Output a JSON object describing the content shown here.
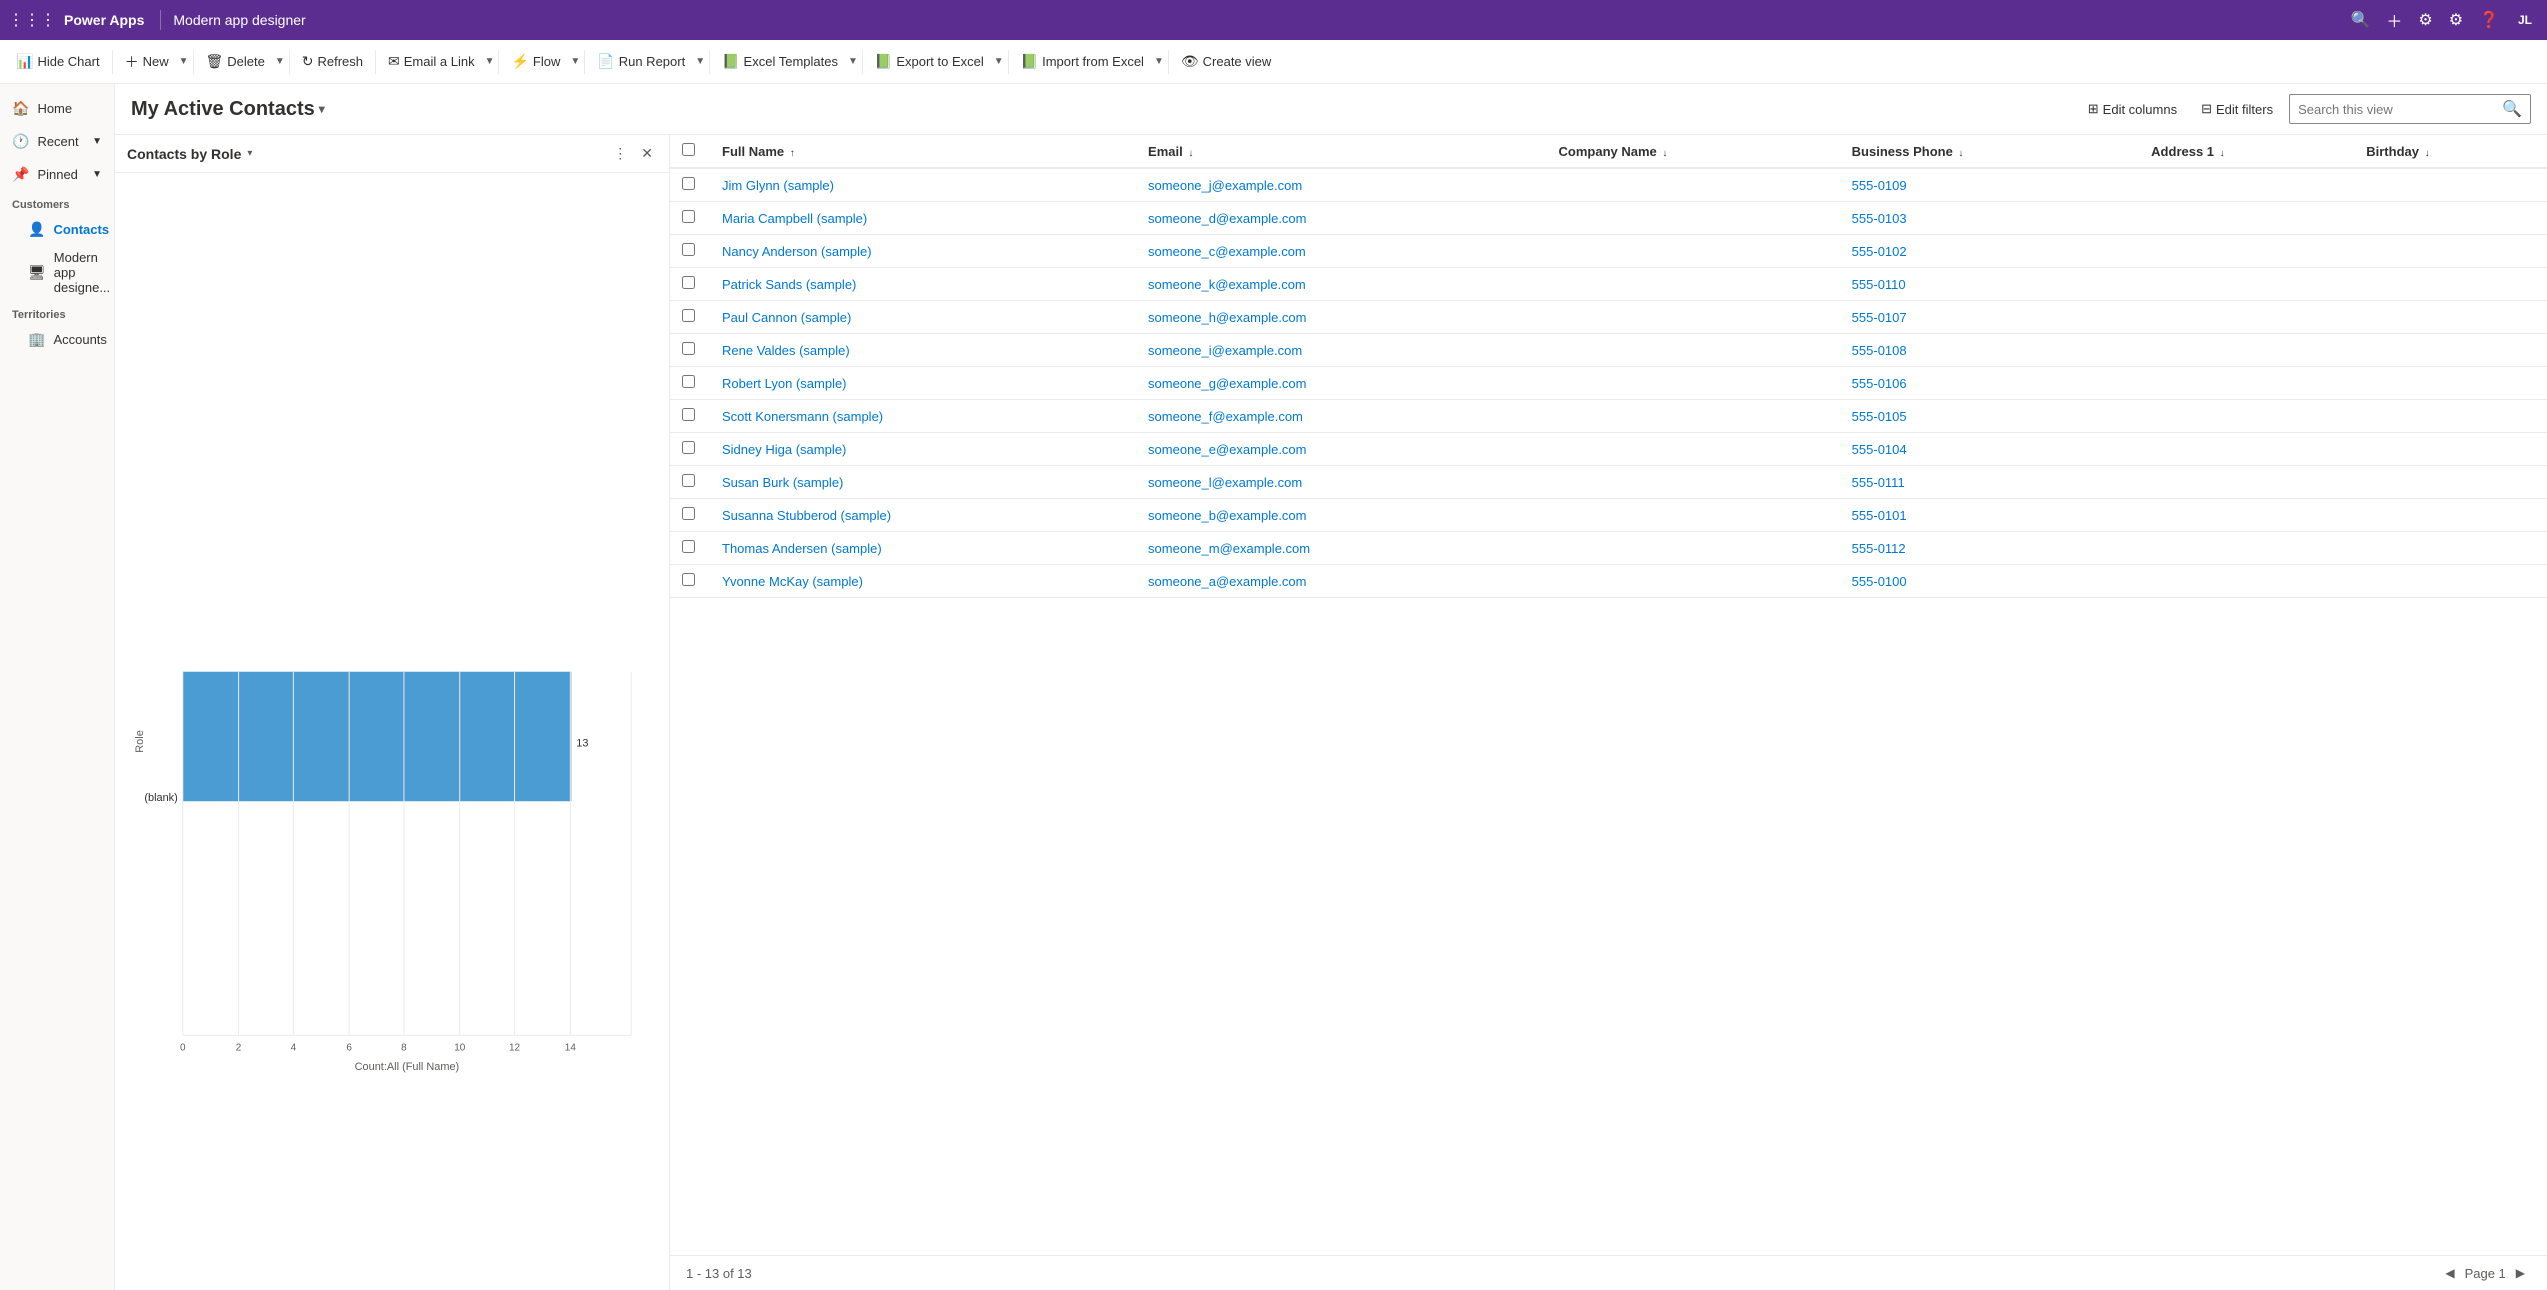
{
  "app": {
    "name": "Power Apps",
    "page_name": "Modern app designer",
    "user_initials": "JL"
  },
  "toolbar": {
    "buttons": [
      {
        "id": "hide-chart",
        "label": "Hide Chart",
        "icon": "📊"
      },
      {
        "id": "new",
        "label": "New",
        "icon": "＋"
      },
      {
        "id": "delete",
        "label": "Delete",
        "icon": "🗑"
      },
      {
        "id": "refresh",
        "label": "Refresh",
        "icon": "↻"
      },
      {
        "id": "email-link",
        "label": "Email a Link",
        "icon": "✉"
      },
      {
        "id": "flow",
        "label": "Flow",
        "icon": "⚡"
      },
      {
        "id": "run-report",
        "label": "Run Report",
        "icon": "📄"
      },
      {
        "id": "excel-templates",
        "label": "Excel Templates",
        "icon": "📗"
      },
      {
        "id": "export-to-excel",
        "label": "Export to Excel",
        "icon": "📗"
      },
      {
        "id": "import-from-excel",
        "label": "Import from Excel",
        "icon": "📗"
      },
      {
        "id": "create-view",
        "label": "Create view",
        "icon": "👁"
      }
    ]
  },
  "sidebar": {
    "nav_items": [
      {
        "id": "home",
        "label": "Home",
        "icon": "🏠",
        "has_expand": false
      },
      {
        "id": "recent",
        "label": "Recent",
        "icon": "🕐",
        "has_expand": true
      },
      {
        "id": "pinned",
        "label": "Pinned",
        "icon": "📌",
        "has_expand": true
      }
    ],
    "sections": [
      {
        "header": "Customers",
        "items": [
          {
            "id": "contacts",
            "label": "Contacts",
            "icon": "👤",
            "active": true
          },
          {
            "id": "modern-app-designer",
            "label": "Modern app designe...",
            "icon": "🖥",
            "active": false
          }
        ]
      },
      {
        "header": "Territories",
        "items": [
          {
            "id": "accounts",
            "label": "Accounts",
            "icon": "🏢",
            "active": false
          }
        ]
      }
    ]
  },
  "view": {
    "title": "My Active Contacts",
    "actions": [
      {
        "id": "edit-columns",
        "label": "Edit columns",
        "icon": "⊞"
      },
      {
        "id": "edit-filters",
        "label": "Edit filters",
        "icon": "⊟"
      },
      {
        "id": "search-view",
        "placeholder": "Search this view"
      }
    ]
  },
  "chart": {
    "title": "Contacts by Role",
    "bar_label": "(blank)",
    "bar_value": 13,
    "axis_label": "Count:All (Full Name)",
    "y_axis_label": "Role",
    "x_ticks": [
      0,
      2,
      4,
      6,
      8,
      10,
      12,
      14
    ],
    "bar_color": "#4c9cd4"
  },
  "grid": {
    "columns": [
      {
        "id": "full-name",
        "label": "Full Name",
        "sortable": true,
        "sort": "asc"
      },
      {
        "id": "email",
        "label": "Email",
        "sortable": true
      },
      {
        "id": "company-name",
        "label": "Company Name",
        "sortable": true
      },
      {
        "id": "business-phone",
        "label": "Business Phone",
        "sortable": true
      },
      {
        "id": "address1",
        "label": "Address 1",
        "sortable": true
      },
      {
        "id": "birthday",
        "label": "Birthday",
        "sortable": true
      }
    ],
    "rows": [
      {
        "name": "Jim Glynn (sample)",
        "email": "someone_j@example.com",
        "company": "",
        "phone": "555-0109",
        "address": "",
        "birthday": ""
      },
      {
        "name": "Maria Campbell (sample)",
        "email": "someone_d@example.com",
        "company": "",
        "phone": "555-0103",
        "address": "",
        "birthday": ""
      },
      {
        "name": "Nancy Anderson (sample)",
        "email": "someone_c@example.com",
        "company": "",
        "phone": "555-0102",
        "address": "",
        "birthday": ""
      },
      {
        "name": "Patrick Sands (sample)",
        "email": "someone_k@example.com",
        "company": "",
        "phone": "555-0110",
        "address": "",
        "birthday": ""
      },
      {
        "name": "Paul Cannon (sample)",
        "email": "someone_h@example.com",
        "company": "",
        "phone": "555-0107",
        "address": "",
        "birthday": ""
      },
      {
        "name": "Rene Valdes (sample)",
        "email": "someone_i@example.com",
        "company": "",
        "phone": "555-0108",
        "address": "",
        "birthday": ""
      },
      {
        "name": "Robert Lyon (sample)",
        "email": "someone_g@example.com",
        "company": "",
        "phone": "555-0106",
        "address": "",
        "birthday": ""
      },
      {
        "name": "Scott Konersmann (sample)",
        "email": "someone_f@example.com",
        "company": "",
        "phone": "555-0105",
        "address": "",
        "birthday": ""
      },
      {
        "name": "Sidney Higa (sample)",
        "email": "someone_e@example.com",
        "company": "",
        "phone": "555-0104",
        "address": "",
        "birthday": ""
      },
      {
        "name": "Susan Burk (sample)",
        "email": "someone_l@example.com",
        "company": "",
        "phone": "555-0111",
        "address": "",
        "birthday": ""
      },
      {
        "name": "Susanna Stubberod (sample)",
        "email": "someone_b@example.com",
        "company": "",
        "phone": "555-0101",
        "address": "",
        "birthday": ""
      },
      {
        "name": "Thomas Andersen (sample)",
        "email": "someone_m@example.com",
        "company": "",
        "phone": "555-0112",
        "address": "",
        "birthday": ""
      },
      {
        "name": "Yvonne McKay (sample)",
        "email": "someone_a@example.com",
        "company": "",
        "phone": "555-0100",
        "address": "",
        "birthday": ""
      }
    ],
    "record_info": "1 - 13 of 13",
    "page_info": "Page 1"
  }
}
